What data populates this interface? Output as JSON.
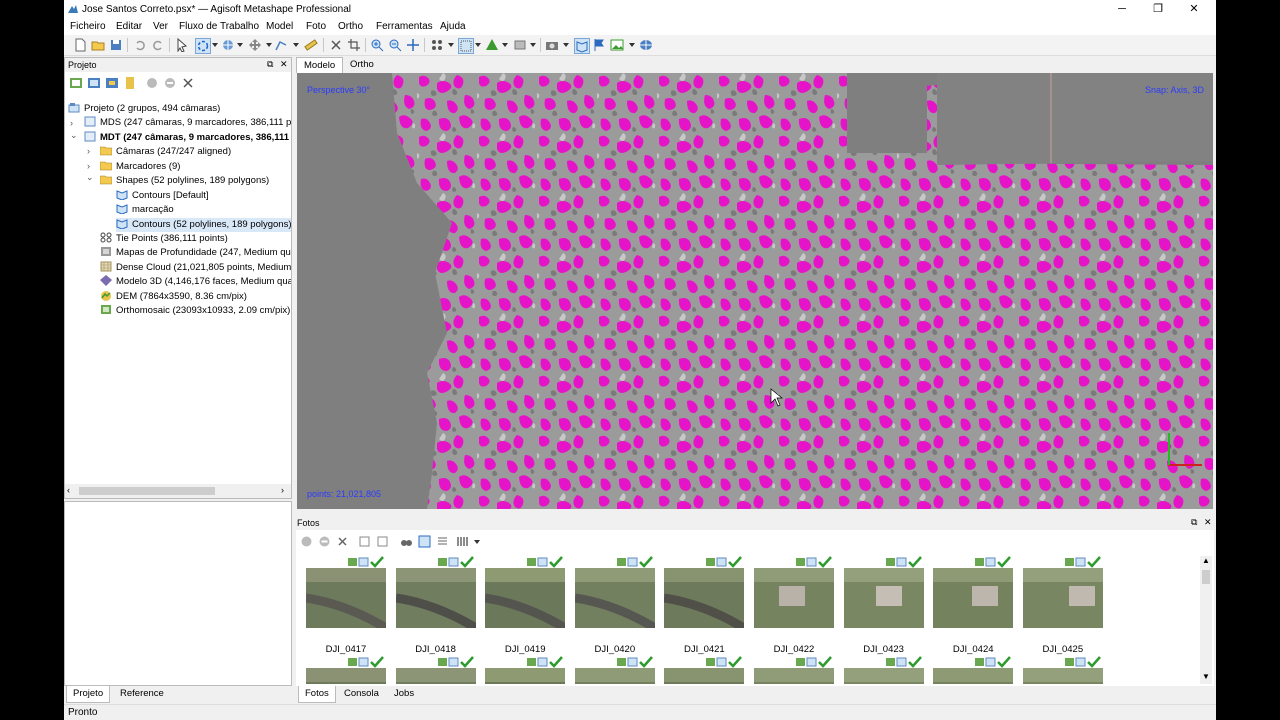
{
  "window": {
    "title": "Jose Santos Correto.psx* — Agisoft Metashape Professional",
    "minimize": "─",
    "restore": "❐",
    "close": "✕"
  },
  "menu": [
    "Ficheiro",
    "Editar",
    "Ver",
    "Fluxo de Trabalho",
    "Model",
    "Foto",
    "Ortho",
    "Ferramentas",
    "Ajuda"
  ],
  "project_panel": {
    "title": "Projeto",
    "tree": [
      {
        "label": "Projeto (2 grupos, 494 câmaras)",
        "icon": "project-icon",
        "level": 0,
        "arrow": "",
        "bold": false
      },
      {
        "label": "MDS (247 câmaras, 9 marcadores, 386,111 po",
        "icon": "chunk-icon",
        "level": 1,
        "arrow": "›",
        "bold": false
      },
      {
        "label": "MDT (247 câmaras, 9 marcadores, 386,111",
        "icon": "chunk-icon",
        "level": 1,
        "arrow": "⌄",
        "bold": true
      },
      {
        "label": "Câmaras (247/247 aligned)",
        "icon": "folder-icon",
        "level": 2,
        "arrow": "›",
        "bold": false
      },
      {
        "label": "Marcadores (9)",
        "icon": "folder-icon",
        "level": 2,
        "arrow": "›",
        "bold": false
      },
      {
        "label": "Shapes (52 polylines, 189 polygons)",
        "icon": "folder-icon",
        "level": 2,
        "arrow": "⌄",
        "bold": false
      },
      {
        "label": "Contours [Default]",
        "icon": "shape-layer-icon",
        "level": 3,
        "arrow": "",
        "bold": false
      },
      {
        "label": "marcação",
        "icon": "shape-layer-icon",
        "level": 3,
        "arrow": "",
        "bold": false
      },
      {
        "label": "Contours (52 polylines, 189 polygons)",
        "icon": "shape-layer-icon",
        "level": 3,
        "arrow": "",
        "bold": false,
        "selected": true
      },
      {
        "label": "Tie Points (386,111 points)",
        "icon": "tie-points-icon",
        "level": 2,
        "arrow": "",
        "bold": false
      },
      {
        "label": "Mapas de Profundidade (247, Medium qu",
        "icon": "depth-maps-icon",
        "level": 2,
        "arrow": "",
        "bold": false
      },
      {
        "label": "Dense Cloud (21,021,805 points, Medium",
        "icon": "dense-cloud-icon",
        "level": 2,
        "arrow": "",
        "bold": false
      },
      {
        "label": "Modelo 3D (4,146,176 faces, Medium qua",
        "icon": "model-icon",
        "level": 2,
        "arrow": "",
        "bold": false
      },
      {
        "label": "DEM (7864x3590, 8.36 cm/pix)",
        "icon": "dem-icon",
        "level": 2,
        "arrow": "",
        "bold": false
      },
      {
        "label": "Orthomosaic (23093x10933, 2.09 cm/pix)",
        "icon": "ortho-icon",
        "level": 2,
        "arrow": "",
        "bold": false
      }
    ]
  },
  "left_tabs": [
    "Projeto",
    "Reference"
  ],
  "view_tabs": [
    "Modelo",
    "Ortho"
  ],
  "viewport": {
    "perspective": "Perspective 30°",
    "snap": "Snap: Axis, 3D",
    "points": "points: 21,021,805"
  },
  "fotos_panel": {
    "title": "Fotos",
    "photos": [
      "DJI_0417",
      "DJI_0418",
      "DJI_0419",
      "DJI_0420",
      "DJI_0421",
      "DJI_0422",
      "DJI_0423",
      "DJI_0424",
      "DJI_0425"
    ]
  },
  "bottom_tabs": [
    "Fotos",
    "Consola",
    "Jobs"
  ],
  "status": "Pronto",
  "colors": {
    "accent": "#2b3bff",
    "cloud_magenta": "#e614c8",
    "viewport_bg": "#7f7f7f"
  }
}
